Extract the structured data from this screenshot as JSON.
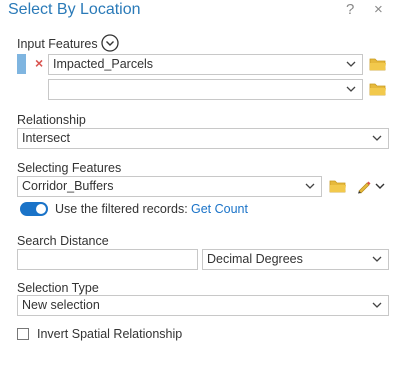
{
  "header": {
    "title": "Select By Location",
    "help_glyph": "?",
    "close_glyph": "×"
  },
  "input_features": {
    "label": "Input Features",
    "rows": [
      {
        "value": "Impacted_Parcels",
        "remove_glyph": "×"
      },
      {
        "value": ""
      }
    ]
  },
  "relationship": {
    "label": "Relationship",
    "value": "Intersect"
  },
  "selecting_features": {
    "label": "Selecting Features",
    "value": "Corridor_Buffers",
    "toggle_on": true,
    "toggle_label": "Use the filtered records:",
    "get_count_link": "Get Count"
  },
  "search_distance": {
    "label": "Search Distance",
    "value": "",
    "unit": "Decimal Degrees"
  },
  "selection_type": {
    "label": "Selection Type",
    "value": "New selection"
  },
  "invert": {
    "label": "Invert Spatial Relationship",
    "checked": false
  },
  "colors": {
    "title": "#2a7ab8",
    "accent": "#1a73c8",
    "folder": "#e6b93c",
    "remove": "#d9534f"
  },
  "icons": [
    "expand-circle-icon",
    "remove-icon",
    "chevron-down-icon",
    "folder-icon",
    "pencil-icon",
    "help-icon",
    "close-icon"
  ]
}
